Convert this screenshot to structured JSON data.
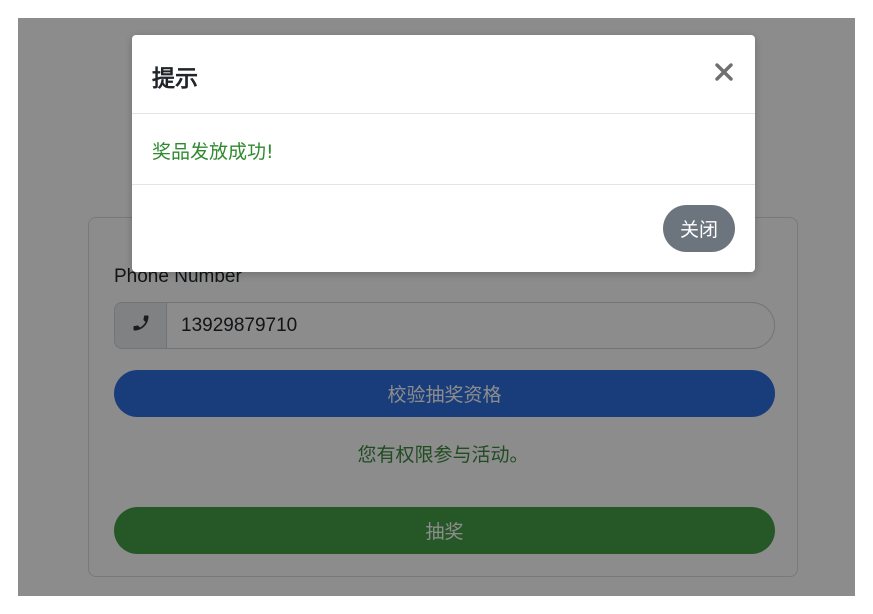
{
  "form": {
    "phone_label": "Phone Number",
    "phone_value": "13929879710",
    "prefix_icon": "phone-icon",
    "verify_label": "校验抽奖资格",
    "eligibility_message": "您有权限参与活动。",
    "draw_label": "抽奖"
  },
  "modal": {
    "title": "提示",
    "close_icon": "close-icon",
    "message": "奖品发放成功!",
    "close_button_label": "关闭"
  },
  "colors": {
    "primary": "#2e6fe0",
    "success": "#46a047",
    "secondary": "#6c757d",
    "success_text": "#2f8a2f"
  }
}
